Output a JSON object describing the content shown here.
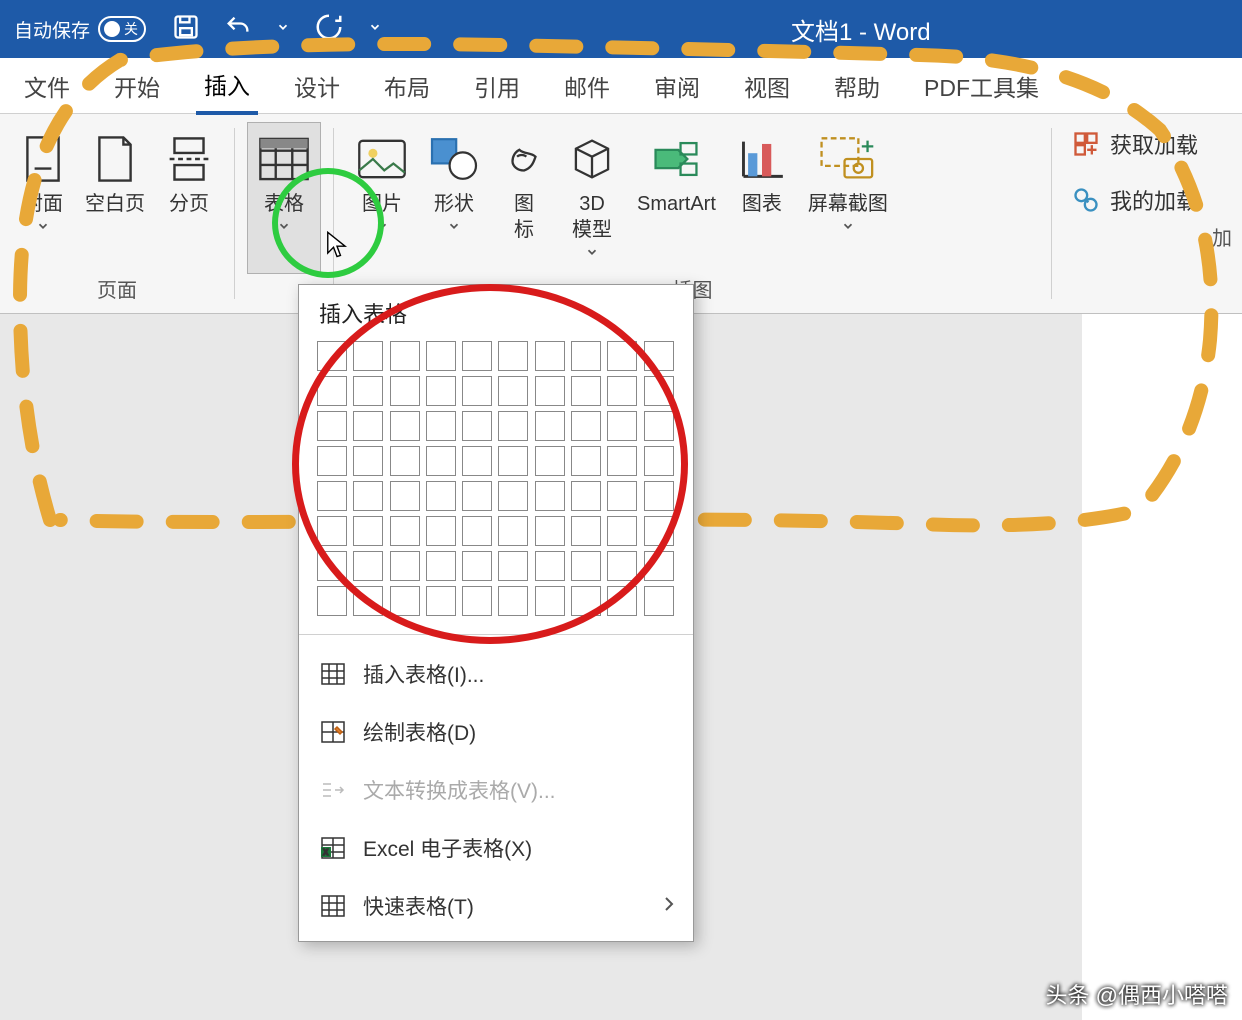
{
  "titlebar": {
    "autosave": "自动保存",
    "toggle_state": "关",
    "doc_title": "文档1  -  Word"
  },
  "tabs": {
    "file": "文件",
    "home": "开始",
    "insert": "插入",
    "design": "设计",
    "layout": "布局",
    "references": "引用",
    "mail": "邮件",
    "review": "审阅",
    "view": "视图",
    "help": "帮助",
    "pdf": "PDF工具集"
  },
  "ribbon": {
    "pages": {
      "cover": "封面",
      "blank": "空白页",
      "break": "分页",
      "group": "页面"
    },
    "table": {
      "label": "表格"
    },
    "illustrations": {
      "picture": "图片",
      "shapes": "形状",
      "icons": "图\n标",
      "model3d": "3D\n模型",
      "smartart": "SmartArt",
      "chart": "图表",
      "screenshot": "屏幕截图",
      "group": "插图"
    },
    "addins": {
      "get": "获取加载",
      "my": "我的加载",
      "group": "加"
    }
  },
  "dropdown": {
    "title": "插入表格",
    "insert_table": "插入表格(I)...",
    "draw_table": "绘制表格(D)",
    "convert_text": "文本转换成表格(V)...",
    "excel": "Excel 电子表格(X)",
    "quick": "快速表格(T)"
  },
  "watermark": "头条 @偶西小嗒嗒"
}
